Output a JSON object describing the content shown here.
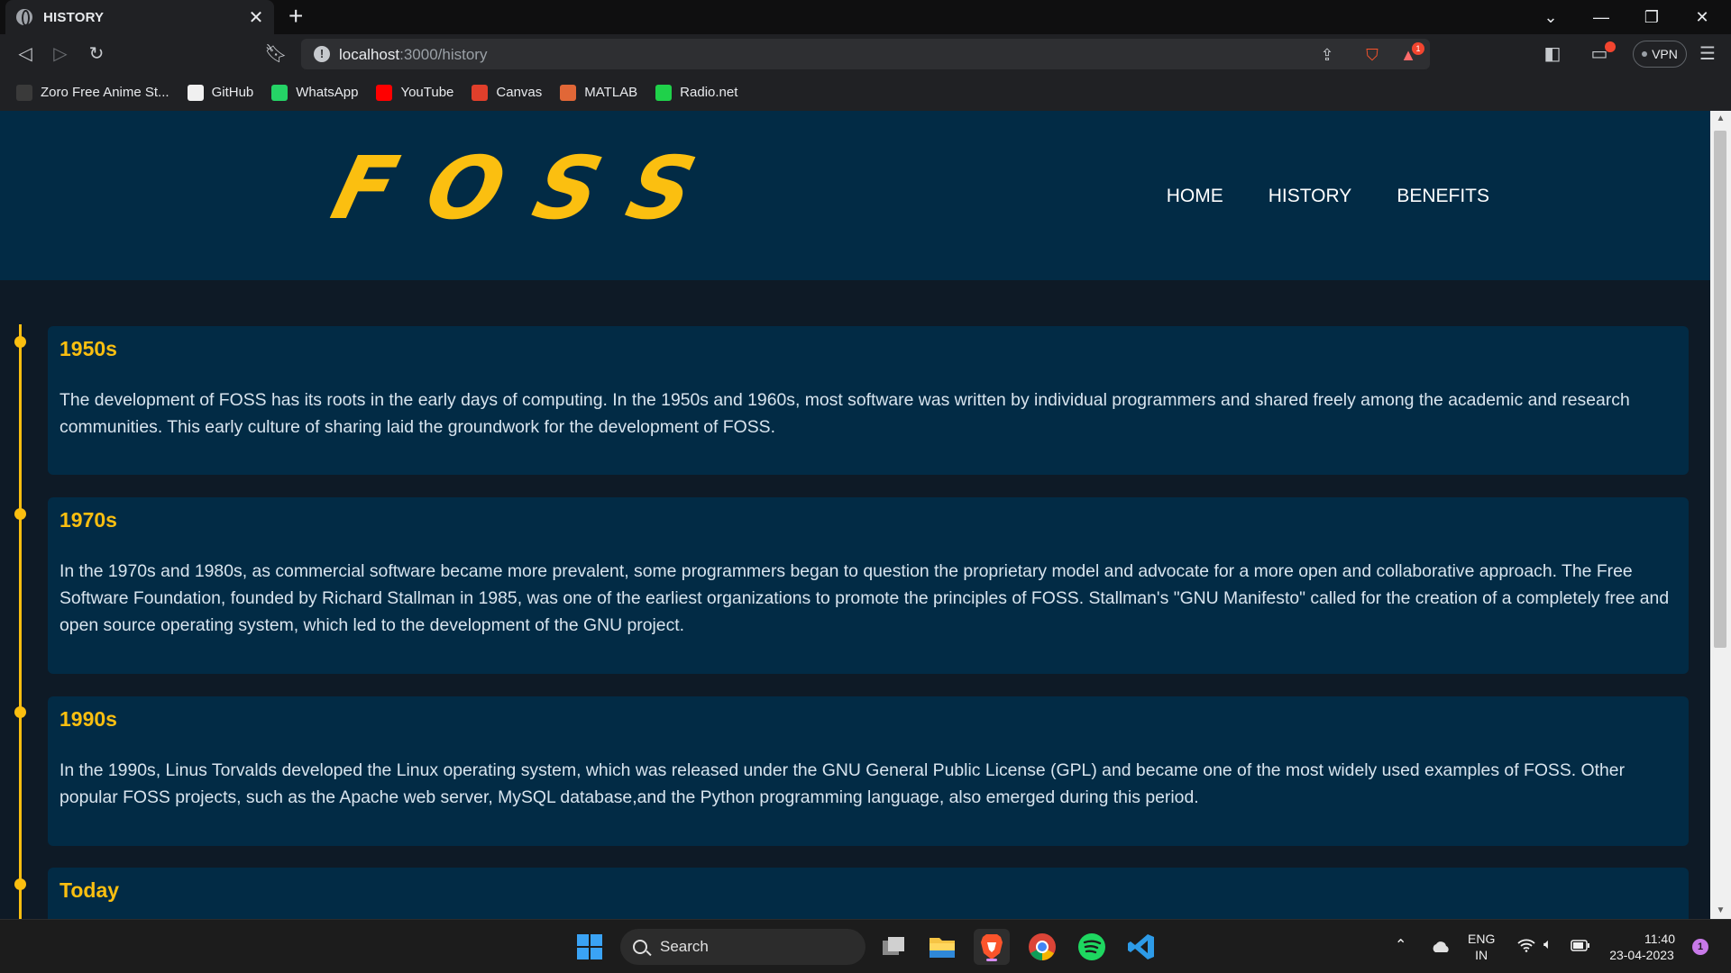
{
  "browser": {
    "tab_title": "HISTORY",
    "tab_close": "✕",
    "new_tab": "+",
    "url_host": "localhost",
    "url_path": ":3000/history",
    "vpn_label": "VPN",
    "rewards_count": "1",
    "bookmarks": [
      {
        "label": "Zoro Free Anime St...",
        "icon": "zoro-icon",
        "color": "#3a3a3a"
      },
      {
        "label": "GitHub",
        "icon": "github-icon",
        "color": "#f0f0f0"
      },
      {
        "label": "WhatsApp",
        "icon": "whatsapp-icon",
        "color": "#25d366"
      },
      {
        "label": "YouTube",
        "icon": "youtube-icon",
        "color": "#ff0000"
      },
      {
        "label": "Canvas",
        "icon": "canvas-icon",
        "color": "#e13f2b"
      },
      {
        "label": "MATLAB",
        "icon": "matlab-icon",
        "color": "#e16737"
      },
      {
        "label": "Radio.net",
        "icon": "radio-icon",
        "color": "#1fd14a"
      }
    ]
  },
  "site": {
    "logo": "FOSS",
    "nav": [
      "HOME",
      "HISTORY",
      "BENEFITS"
    ],
    "accent": "#fbbf10",
    "header_bg": "#022b45",
    "page_bg": "#0e1a26"
  },
  "timeline": [
    {
      "era": "1950s",
      "text": "The development of FOSS has its roots in the early days of computing. In the 1950s and 1960s, most software was written by individual programmers and shared freely among the academic and research communities. This early culture of sharing laid the groundwork for the development of FOSS."
    },
    {
      "era": "1970s",
      "text": "In the 1970s and 1980s, as commercial software became more prevalent, some programmers began to question the proprietary model and advocate for a more open and collaborative approach. The Free Software Foundation, founded by Richard Stallman in 1985, was one of the earliest organizations to promote the principles of FOSS. Stallman's \"GNU Manifesto\" called for the creation of a completely free and open source operating system, which led to the development of the GNU project."
    },
    {
      "era": "1990s",
      "text": "In the 1990s, Linus Torvalds developed the Linux operating system, which was released under the GNU General Public License (GPL) and became one of the most widely used examples of FOSS. Other popular FOSS projects, such as the Apache web server, MySQL database,and the Python programming language, also emerged during this period."
    },
    {
      "era": "Today",
      "text": ""
    }
  ],
  "taskbar": {
    "search_label": "Search",
    "lang_top": "ENG",
    "lang_bottom": "IN",
    "time": "11:40",
    "date": "23-04-2023",
    "notification_count": "1"
  }
}
